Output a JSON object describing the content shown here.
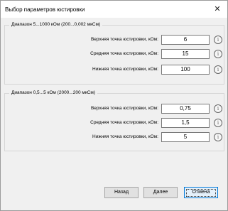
{
  "window": {
    "title": "Выбор параметров юстировки"
  },
  "groups": [
    {
      "title": "Диапазон 5...1000 кОм (200...0,002 мкСм)",
      "rows": [
        {
          "label": "Верхняя точка юстировки, кОм:",
          "value": "6"
        },
        {
          "label": "Средняя точка юстировки, кОм:",
          "value": "15"
        },
        {
          "label": "Нижняя точка юстировки, кОм:",
          "value": "100"
        }
      ]
    },
    {
      "title": "Диапазон 0,5...5 кОм (2000...200 мкСм)",
      "rows": [
        {
          "label": "Верхняя точка юстировки, кОм:",
          "value": "0,75"
        },
        {
          "label": "Средняя точка юстировки, кОм:",
          "value": "1,5"
        },
        {
          "label": "Нижняя точка юстировки, кОм:",
          "value": "5"
        }
      ]
    }
  ],
  "buttons": {
    "back": "Назад",
    "next": "Далее",
    "cancel": "Отмена"
  }
}
